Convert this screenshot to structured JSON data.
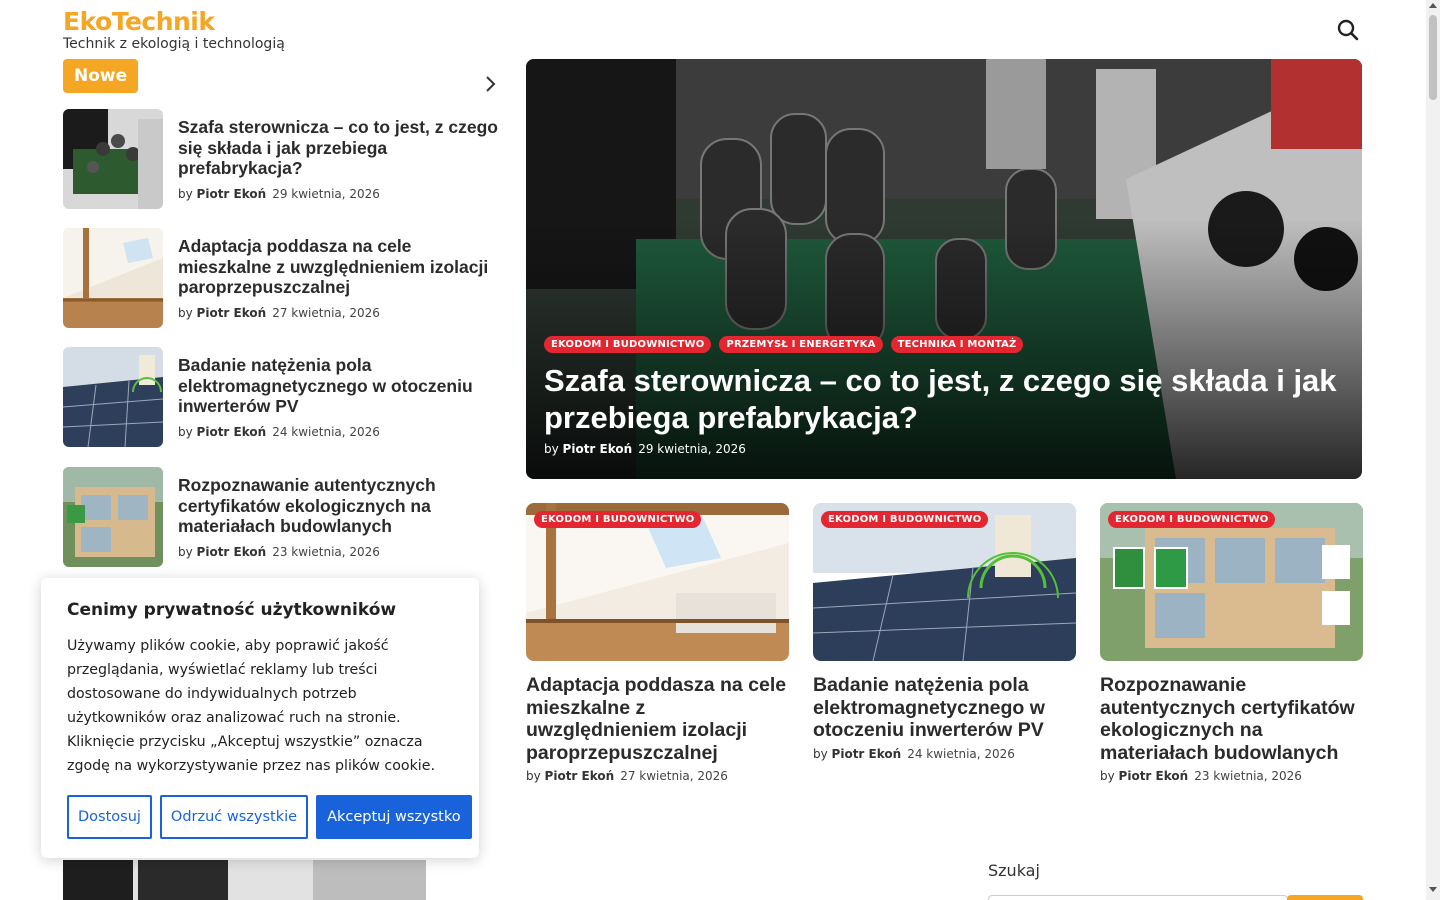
{
  "site": {
    "title": "EkoTechnik",
    "tagline": "Technik z ekologią i technologią"
  },
  "icons": {
    "search": "search-icon",
    "next": "chevron-right-icon"
  },
  "colors": {
    "brand": "#f5a623",
    "category": "#e3262f",
    "cookie_accent": "#1863dc"
  },
  "nowe": {
    "label": "Nowe"
  },
  "news_list": [
    {
      "title": "Szafa sterownicza – co to jest, z czego się składa i jak przebiega prefabrykacja?",
      "by": "by",
      "author": "Piotr Ekoń",
      "date": "29 kwietnia, 2026"
    },
    {
      "title": "Adaptacja poddasza na cele mieszkalne z uwzględnieniem izolacji paroprzepuszczalnej",
      "by": "by",
      "author": "Piotr Ekoń",
      "date": "27 kwietnia, 2026"
    },
    {
      "title": "Badanie natężenia pola elektromagnetycznego w otoczeniu inwerterów PV",
      "by": "by",
      "author": "Piotr Ekoń",
      "date": "24 kwietnia, 2026"
    },
    {
      "title": "Rozpoznawanie autentycznych certyfikatów ekologicznych na materiałach budowlanych",
      "by": "by",
      "author": "Piotr Ekoń",
      "date": "23 kwietnia, 2026"
    }
  ],
  "hero": {
    "categories": [
      "EKODOM I BUDOWNICTWO",
      "PRZEMYSŁ I ENERGETYKA",
      "TECHNIKA I MONTAŻ"
    ],
    "title": "Szafa sterownicza – co to jest, z czego się składa i jak przebiega prefabrykacja?",
    "by": "by",
    "author": "Piotr Ekoń",
    "date": "29 kwietnia, 2026"
  },
  "cards": [
    {
      "category": "EKODOM I BUDOWNICTWO",
      "title": "Adaptacja poddasza na cele mieszkalne z uwzględnieniem izolacji paroprzepuszczalnej",
      "by": "by",
      "author": "Piotr Ekoń",
      "date": "27 kwietnia, 2026"
    },
    {
      "category": "EKODOM I BUDOWNICTWO",
      "title": "Badanie natężenia pola elektromagnetycznego w otoczeniu inwerterów PV",
      "by": "by",
      "author": "Piotr Ekoń",
      "date": "24 kwietnia, 2026"
    },
    {
      "category": "EKODOM I BUDOWNICTWO",
      "title": "Rozpoznawanie autentycznych certyfikatów ekologicznych na materiałach budowlanych",
      "by": "by",
      "author": "Piotr Ekoń",
      "date": "23 kwietnia, 2026"
    }
  ],
  "search_widget": {
    "label": "Szukaj"
  },
  "cookie": {
    "title": "Cenimy prywatność użytkowników",
    "text": "Używamy plików cookie, aby poprawić jakość przeglądania, wyświetlać reklamy lub treści dostosowane do indywidualnych potrzeb użytkowników oraz analizować ruch na stronie. Kliknięcie przycisku „Akceptuj wszystkie” oznacza zgodę na wykorzystywanie przez nas plików cookie.",
    "customize": "Dostosuj",
    "reject": "Odrzuć wszystkie",
    "accept": "Akceptuj wszystko"
  }
}
